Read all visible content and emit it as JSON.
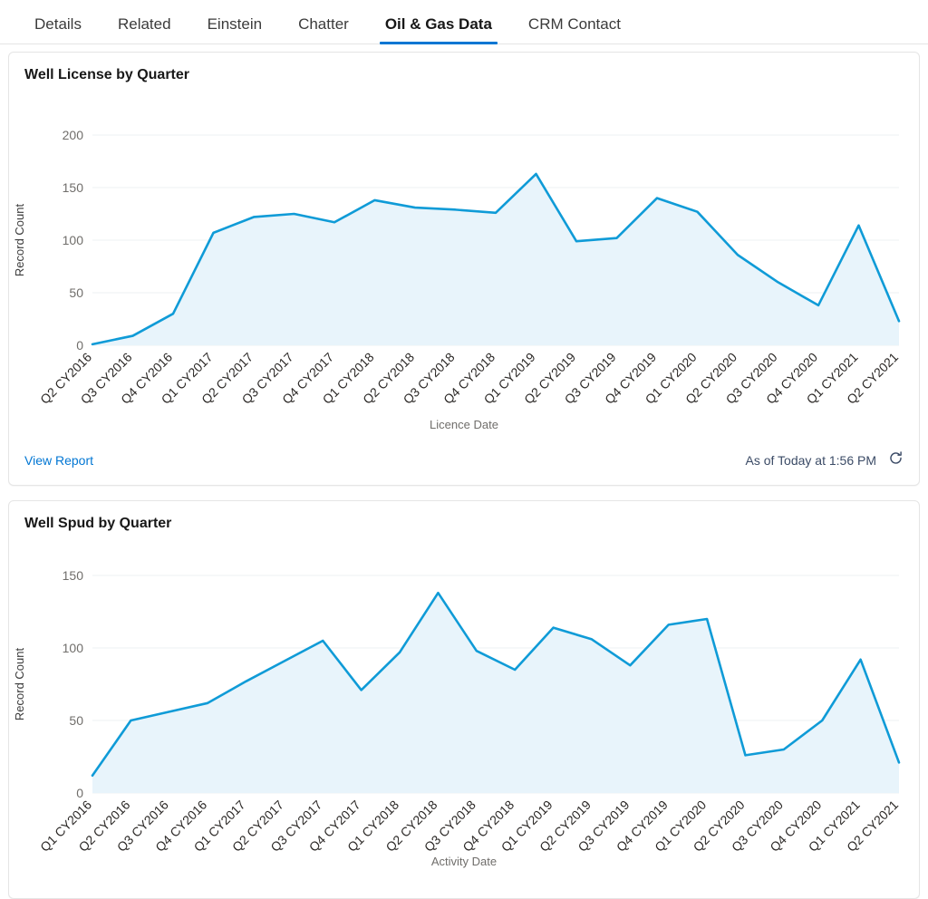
{
  "tabs": [
    {
      "label": "Details",
      "active": false
    },
    {
      "label": "Related",
      "active": false
    },
    {
      "label": "Einstein",
      "active": false
    },
    {
      "label": "Chatter",
      "active": false
    },
    {
      "label": "Oil & Gas Data",
      "active": true
    },
    {
      "label": "CRM Contact",
      "active": false
    }
  ],
  "colors": {
    "accent": "#0176d3",
    "line": "#0f9bd7",
    "area": "#e8f4fb",
    "grid": "#eef1f3",
    "tick_text": "#706e6b",
    "title_text": "#181818"
  },
  "cards": [
    {
      "title": "Well License by Quarter",
      "footer": {
        "view_report_label": "View Report",
        "as_of_label": "As of Today at 1:56 PM",
        "refresh_icon": "refresh-icon"
      }
    },
    {
      "title": "Well Spud by Quarter",
      "footer": null
    }
  ],
  "chart_data": [
    {
      "type": "area",
      "title": "Well License by Quarter",
      "xlabel": "Licence Date",
      "ylabel": "Record Count",
      "ylim": [
        0,
        200
      ],
      "yticks": [
        0,
        50,
        100,
        150,
        200
      ],
      "grid": true,
      "legend": "none",
      "categories": [
        "Q2 CY2016",
        "Q3 CY2016",
        "Q4 CY2016",
        "Q1 CY2017",
        "Q2 CY2017",
        "Q3 CY2017",
        "Q4 CY2017",
        "Q1 CY2018",
        "Q2 CY2018",
        "Q3 CY2018",
        "Q4 CY2018",
        "Q1 CY2019",
        "Q2 CY2019",
        "Q3 CY2019",
        "Q4 CY2019",
        "Q1 CY2020",
        "Q2 CY2020",
        "Q3 CY2020",
        "Q4 CY2020",
        "Q1 CY2021",
        "Q2 CY2021"
      ],
      "values": [
        1,
        9,
        30,
        107,
        122,
        125,
        117,
        138,
        131,
        129,
        126,
        163,
        99,
        102,
        140,
        127,
        86,
        60,
        38,
        114,
        23
      ]
    },
    {
      "type": "area",
      "title": "Well Spud by Quarter",
      "xlabel": "Activity Date",
      "ylabel": "Record Count",
      "ylim": [
        0,
        150
      ],
      "yticks": [
        0,
        50,
        100,
        150
      ],
      "grid": true,
      "legend": "none",
      "categories": [
        "Q1 CY2016",
        "Q2 CY2016",
        "Q3 CY2016",
        "Q4 CY2016",
        "Q1 CY2017",
        "Q2 CY2017",
        "Q3 CY2017",
        "Q4 CY2017",
        "Q1 CY2018",
        "Q2 CY2018",
        "Q3 CY2018",
        "Q4 CY2018",
        "Q1 CY2019",
        "Q2 CY2019",
        "Q3 CY2019",
        "Q4 CY2019",
        "Q1 CY2020",
        "Q2 CY2020",
        "Q3 CY2020",
        "Q4 CY2020",
        "Q1 CY2021",
        "Q2 CY2021"
      ],
      "values": [
        12,
        50,
        56,
        62,
        77,
        91,
        105,
        71,
        97,
        138,
        98,
        85,
        114,
        106,
        88,
        116,
        120,
        26,
        30,
        50,
        92,
        21
      ]
    }
  ]
}
